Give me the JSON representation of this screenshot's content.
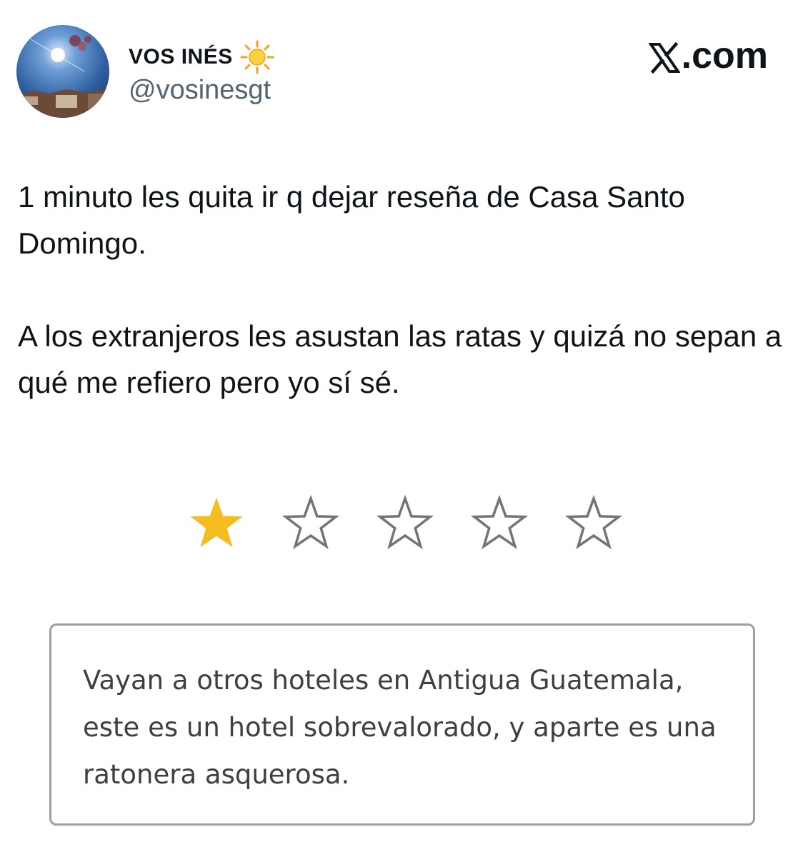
{
  "header": {
    "display_name": "VOS INÉS",
    "display_name_icon": "sun-icon",
    "handle": "@vosinesgt",
    "brand": ".com",
    "brand_icon": "x-logo-icon"
  },
  "tweet": {
    "paragraphs": [
      "1 minuto les quita ir q dejar reseña de Casa Santo Domingo.",
      "A los extranjeros les asustan las ratas y quizá no sepan a qué me refiero pero yo sí sé."
    ]
  },
  "review": {
    "rating": 1,
    "max_rating": 5,
    "star_filled_color": "#f5bd1f",
    "star_empty_color": "#70757a",
    "text": "Vayan a otros hoteles en Antigua Guatemala, este es un hotel sobrevalorado, y aparte es una ratonera asquerosa."
  }
}
